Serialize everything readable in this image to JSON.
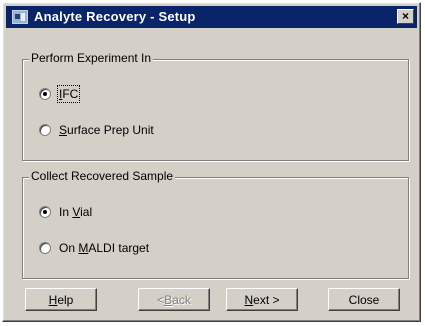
{
  "window": {
    "title": "Analyte Recovery - Setup",
    "close_symbol": "×"
  },
  "group_experiment": {
    "label": "Perform Experiment In",
    "options": [
      {
        "pre": "",
        "u": "I",
        "post": "FC",
        "checked": true
      },
      {
        "pre": "",
        "u": "S",
        "post": "urface Prep Unit",
        "checked": false
      }
    ]
  },
  "group_collect": {
    "label": "Collect Recovered Sample",
    "options": [
      {
        "pre": "In ",
        "u": "V",
        "post": "ial",
        "checked": true
      },
      {
        "pre": "On ",
        "u": "M",
        "post": "ALDI target",
        "checked": false
      }
    ]
  },
  "buttons": {
    "help": {
      "u": "H",
      "post": "elp"
    },
    "back": {
      "pre": "< ",
      "u": "B",
      "post": "ack"
    },
    "next": {
      "u": "N",
      "post": "ext >"
    },
    "close": {
      "label": "Close"
    }
  },
  "colors": {
    "titlebar": "#0a246a",
    "face": "#d4d0c8"
  }
}
